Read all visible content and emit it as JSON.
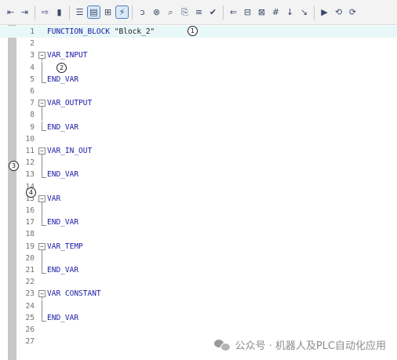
{
  "toolbar": {
    "buttons": [
      {
        "icon": "indent-decrease-icon",
        "glyph": "⇤"
      },
      {
        "icon": "indent-increase-icon",
        "glyph": "⇥"
      },
      {
        "icon": "go-to-line-icon",
        "glyph": "⇨"
      },
      {
        "icon": "bookmark-icon",
        "glyph": "▮"
      },
      {
        "icon": "align-list-icon",
        "glyph": "☰"
      },
      {
        "icon": "format-block-icon",
        "glyph": "▤",
        "active": true
      },
      {
        "icon": "network-declaration-icon",
        "glyph": "⊞"
      },
      {
        "icon": "snippet-insert-icon",
        "glyph": "⚡",
        "active": true
      },
      {
        "icon": "comment-add-icon",
        "glyph": "ↄ"
      },
      {
        "icon": "comment-remove-icon",
        "glyph": "⊗"
      },
      {
        "icon": "find-icon",
        "glyph": "⌕"
      },
      {
        "icon": "replace-icon",
        "glyph": "⎘"
      },
      {
        "icon": "list-icon",
        "glyph": "≡"
      },
      {
        "icon": "check-syntax-icon",
        "glyph": "✔"
      },
      {
        "icon": "jump-back-icon",
        "glyph": "⇐"
      },
      {
        "icon": "monitor-icon",
        "glyph": "⊟"
      },
      {
        "icon": "monitor-all-icon",
        "glyph": "⊠"
      },
      {
        "icon": "grid-icon",
        "glyph": "#"
      },
      {
        "icon": "step-over-icon",
        "glyph": "↓"
      },
      {
        "icon": "step-into-icon",
        "glyph": "↘"
      },
      {
        "icon": "breakpoint-icon",
        "glyph": "▶"
      },
      {
        "icon": "run-to-cursor-icon",
        "glyph": "⟲"
      },
      {
        "icon": "reset-icon",
        "glyph": "⟳"
      }
    ]
  },
  "code_lines": [
    {
      "n": "1",
      "text": "FUNCTION_BLOCK ",
      "str": "\"Block_2\"",
      "fold": ""
    },
    {
      "n": "2",
      "text": "",
      "fold": ""
    },
    {
      "n": "3",
      "text": "VAR_INPUT",
      "fold": "start"
    },
    {
      "n": "4",
      "text": "",
      "fold": "mid"
    },
    {
      "n": "5",
      "text": "END_VAR",
      "fold": "end"
    },
    {
      "n": "6",
      "text": "",
      "fold": ""
    },
    {
      "n": "7",
      "text": "VAR_OUTPUT",
      "fold": "start"
    },
    {
      "n": "8",
      "text": "",
      "fold": "mid"
    },
    {
      "n": "9",
      "text": "END_VAR",
      "fold": "end"
    },
    {
      "n": "10",
      "text": "",
      "fold": ""
    },
    {
      "n": "11",
      "text": "VAR_IN_OUT",
      "fold": "start"
    },
    {
      "n": "12",
      "text": "",
      "fold": "mid"
    },
    {
      "n": "13",
      "text": "END_VAR",
      "fold": "end"
    },
    {
      "n": "14",
      "text": "",
      "fold": ""
    },
    {
      "n": "15",
      "text": "VAR",
      "fold": "start"
    },
    {
      "n": "16",
      "text": "",
      "fold": "mid"
    },
    {
      "n": "17",
      "text": "END_VAR",
      "fold": "end"
    },
    {
      "n": "18",
      "text": "",
      "fold": ""
    },
    {
      "n": "19",
      "text": "VAR_TEMP",
      "fold": "start"
    },
    {
      "n": "20",
      "text": "",
      "fold": "mid"
    },
    {
      "n": "21",
      "text": "END_VAR",
      "fold": "end"
    },
    {
      "n": "22",
      "text": "",
      "fold": ""
    },
    {
      "n": "23",
      "text": "VAR CONSTANT",
      "fold": "start"
    },
    {
      "n": "24",
      "text": "",
      "fold": "mid"
    },
    {
      "n": "25",
      "text": "END_VAR",
      "fold": "end"
    },
    {
      "n": "26",
      "text": "",
      "fold": ""
    },
    {
      "n": "27",
      "text": "",
      "fold": ""
    }
  ],
  "callouts": [
    {
      "label": "1"
    },
    {
      "label": "2"
    },
    {
      "label": "3"
    },
    {
      "label": "4"
    }
  ],
  "watermark": {
    "text": "公众号 · 机器人及PLC自动化应用"
  },
  "colors": {
    "keyword": "#1a1aa6",
    "highlight": "#e8f7f7",
    "margin": "#c7c7c7"
  }
}
